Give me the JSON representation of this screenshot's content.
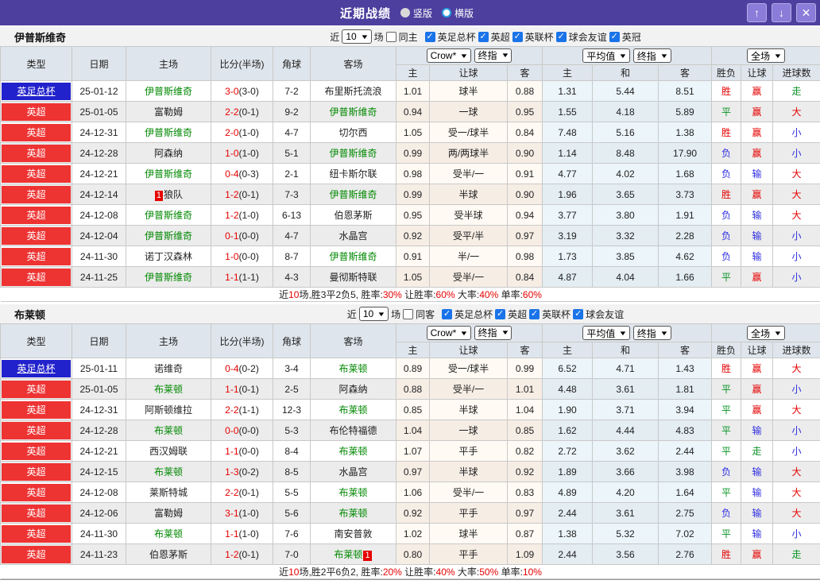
{
  "colors": {
    "titlebar_bg": "#4d3f9e",
    "league_premier_bg": "#ee3333",
    "league_cup_bg": "#2222cc",
    "focus_team_green": "#008800",
    "score_red": "#e60000",
    "win_red": "#e60000",
    "draw_green": "#089424",
    "lose_blue": "#2e2ee0",
    "header_bg": "#dfe5ec",
    "row_alt_bg": "#ececec",
    "checkbox_blue": "#1a73e8"
  },
  "icons": {
    "up": "↑",
    "down": "↓",
    "close": "✕",
    "check": "✓",
    "chevron": "▼"
  },
  "titlebar": {
    "title": "近期战绩",
    "radios": [
      {
        "label": "竖版",
        "style": "filled"
      },
      {
        "label": "横版",
        "style": "blue-ring"
      }
    ]
  },
  "table_header": {
    "cols": [
      "类型",
      "日期",
      "主场",
      "比分(半场)",
      "角球",
      "客场"
    ],
    "odds_group_selects": [
      "Crow*",
      "终指"
    ],
    "avg_group_selects": [
      "平均值",
      "终指"
    ],
    "full_select": "全场",
    "odds_sub": [
      "主",
      "让球",
      "客"
    ],
    "avg_sub": [
      "主",
      "和",
      "客"
    ],
    "result_sub": [
      "胜负",
      "让球",
      "进球数"
    ]
  },
  "sections": [
    {
      "team": "伊普斯维奇",
      "filter": {
        "near_label": "近",
        "count": "10",
        "games_label": "场",
        "same_label": "同主",
        "same_checked": false,
        "leagues": [
          "英足总杯",
          "英超",
          "英联杯",
          "球会友谊",
          "英冠"
        ]
      },
      "rows": [
        {
          "league": "英足总杯",
          "league_style": "cup",
          "date": "25-01-12",
          "home": "伊普斯维奇",
          "home_focus": true,
          "home_badge": null,
          "score_ft": "3-0",
          "score_ht": "(3-0)",
          "corner": "7-2",
          "away": "布里斯托流浪",
          "away_focus": false,
          "away_badge": null,
          "odds": [
            "1.01",
            "球半",
            "0.88"
          ],
          "avg": [
            "1.31",
            "5.44",
            "8.51"
          ],
          "outcome": "胜",
          "let_result": "赢",
          "goal_result": "走"
        },
        {
          "league": "英超",
          "league_style": "red",
          "date": "25-01-05",
          "home": "富勒姆",
          "home_focus": false,
          "home_badge": null,
          "score_ft": "2-2",
          "score_ht": "(0-1)",
          "corner": "9-2",
          "away": "伊普斯维奇",
          "away_focus": true,
          "away_badge": null,
          "odds": [
            "0.94",
            "一球",
            "0.95"
          ],
          "avg": [
            "1.55",
            "4.18",
            "5.89"
          ],
          "outcome": "平",
          "let_result": "赢",
          "goal_result": "大"
        },
        {
          "league": "英超",
          "league_style": "red",
          "date": "24-12-31",
          "home": "伊普斯维奇",
          "home_focus": true,
          "home_badge": null,
          "score_ft": "2-0",
          "score_ht": "(1-0)",
          "corner": "4-7",
          "away": "切尔西",
          "away_focus": false,
          "away_badge": null,
          "odds": [
            "1.05",
            "受一/球半",
            "0.84"
          ],
          "avg": [
            "7.48",
            "5.16",
            "1.38"
          ],
          "outcome": "胜",
          "let_result": "赢",
          "goal_result": "小"
        },
        {
          "league": "英超",
          "league_style": "red",
          "date": "24-12-28",
          "home": "阿森纳",
          "home_focus": false,
          "home_badge": null,
          "score_ft": "1-0",
          "score_ht": "(1-0)",
          "corner": "5-1",
          "away": "伊普斯维奇",
          "away_focus": true,
          "away_badge": null,
          "odds": [
            "0.99",
            "两/两球半",
            "0.90"
          ],
          "avg": [
            "1.14",
            "8.48",
            "17.90"
          ],
          "outcome": "负",
          "let_result": "赢",
          "goal_result": "小"
        },
        {
          "league": "英超",
          "league_style": "red",
          "date": "24-12-21",
          "home": "伊普斯维奇",
          "home_focus": true,
          "home_badge": null,
          "score_ft": "0-4",
          "score_ht": "(0-3)",
          "corner": "2-1",
          "away": "纽卡斯尔联",
          "away_focus": false,
          "away_badge": null,
          "odds": [
            "0.98",
            "受半/一",
            "0.91"
          ],
          "avg": [
            "4.77",
            "4.02",
            "1.68"
          ],
          "outcome": "负",
          "let_result": "输",
          "goal_result": "大"
        },
        {
          "league": "英超",
          "league_style": "red",
          "date": "24-12-14",
          "home": "狼队",
          "home_focus": false,
          "home_badge": {
            "text": "1",
            "pos": "before"
          },
          "score_ft": "1-2",
          "score_ht": "(0-1)",
          "corner": "7-3",
          "away": "伊普斯维奇",
          "away_focus": true,
          "away_badge": null,
          "odds": [
            "0.99",
            "半球",
            "0.90"
          ],
          "avg": [
            "1.96",
            "3.65",
            "3.73"
          ],
          "outcome": "胜",
          "let_result": "赢",
          "goal_result": "大"
        },
        {
          "league": "英超",
          "league_style": "red",
          "date": "24-12-08",
          "home": "伊普斯维奇",
          "home_focus": true,
          "home_badge": null,
          "score_ft": "1-2",
          "score_ht": "(1-0)",
          "corner": "6-13",
          "away": "伯恩茅斯",
          "away_focus": false,
          "away_badge": null,
          "odds": [
            "0.95",
            "受半球",
            "0.94"
          ],
          "avg": [
            "3.77",
            "3.80",
            "1.91"
          ],
          "outcome": "负",
          "let_result": "输",
          "goal_result": "大"
        },
        {
          "league": "英超",
          "league_style": "red",
          "date": "24-12-04",
          "home": "伊普斯维奇",
          "home_focus": true,
          "home_badge": null,
          "score_ft": "0-1",
          "score_ht": "(0-0)",
          "corner": "4-7",
          "away": "水晶宫",
          "away_focus": false,
          "away_badge": null,
          "odds": [
            "0.92",
            "受平/半",
            "0.97"
          ],
          "avg": [
            "3.19",
            "3.32",
            "2.28"
          ],
          "outcome": "负",
          "let_result": "输",
          "goal_result": "小"
        },
        {
          "league": "英超",
          "league_style": "red",
          "date": "24-11-30",
          "home": "诺丁汉森林",
          "home_focus": false,
          "home_badge": null,
          "score_ft": "1-0",
          "score_ht": "(0-0)",
          "corner": "8-7",
          "away": "伊普斯维奇",
          "away_focus": true,
          "away_badge": null,
          "odds": [
            "0.91",
            "半/一",
            "0.98"
          ],
          "avg": [
            "1.73",
            "3.85",
            "4.62"
          ],
          "outcome": "负",
          "let_result": "输",
          "goal_result": "小"
        },
        {
          "league": "英超",
          "league_style": "red",
          "date": "24-11-25",
          "home": "伊普斯维奇",
          "home_focus": true,
          "home_badge": null,
          "score_ft": "1-1",
          "score_ht": "(1-1)",
          "corner": "4-3",
          "away": "曼彻斯特联",
          "away_focus": false,
          "away_badge": null,
          "odds": [
            "1.05",
            "受半/一",
            "0.84"
          ],
          "avg": [
            "4.87",
            "4.04",
            "1.66"
          ],
          "outcome": "平",
          "let_result": "赢",
          "goal_result": "小"
        }
      ],
      "summary": [
        {
          "text": "近"
        },
        {
          "text": "10",
          "red": true
        },
        {
          "text": "场,胜3平2负5, 胜率:"
        },
        {
          "text": "30%",
          "red": true
        },
        {
          "text": " 让胜率:"
        },
        {
          "text": "60%",
          "red": true
        },
        {
          "text": " 大率:"
        },
        {
          "text": "40%",
          "red": true
        },
        {
          "text": " 单率:"
        },
        {
          "text": "60%",
          "red": true
        }
      ]
    },
    {
      "team": "布莱顿",
      "filter": {
        "near_label": "近",
        "count": "10",
        "games_label": "场",
        "same_label": "同客",
        "same_checked": false,
        "leagues": [
          "英足总杯",
          "英超",
          "英联杯",
          "球会友谊"
        ]
      },
      "rows": [
        {
          "league": "英足总杯",
          "league_style": "cup",
          "date": "25-01-11",
          "home": "诺维奇",
          "home_focus": false,
          "home_badge": null,
          "score_ft": "0-4",
          "score_ht": "(0-2)",
          "corner": "3-4",
          "away": "布莱顿",
          "away_focus": true,
          "away_badge": null,
          "odds": [
            "0.89",
            "受一/球半",
            "0.99"
          ],
          "avg": [
            "6.52",
            "4.71",
            "1.43"
          ],
          "outcome": "胜",
          "let_result": "赢",
          "goal_result": "大"
        },
        {
          "league": "英超",
          "league_style": "red",
          "date": "25-01-05",
          "home": "布莱顿",
          "home_focus": true,
          "home_badge": null,
          "score_ft": "1-1",
          "score_ht": "(0-1)",
          "corner": "2-5",
          "away": "阿森纳",
          "away_focus": false,
          "away_badge": null,
          "odds": [
            "0.88",
            "受半/一",
            "1.01"
          ],
          "avg": [
            "4.48",
            "3.61",
            "1.81"
          ],
          "outcome": "平",
          "let_result": "赢",
          "goal_result": "小"
        },
        {
          "league": "英超",
          "league_style": "red",
          "date": "24-12-31",
          "home": "阿斯顿维拉",
          "home_focus": false,
          "home_badge": null,
          "score_ft": "2-2",
          "score_ht": "(1-1)",
          "corner": "12-3",
          "away": "布莱顿",
          "away_focus": true,
          "away_badge": null,
          "odds": [
            "0.85",
            "半球",
            "1.04"
          ],
          "avg": [
            "1.90",
            "3.71",
            "3.94"
          ],
          "outcome": "平",
          "let_result": "赢",
          "goal_result": "大"
        },
        {
          "league": "英超",
          "league_style": "red",
          "date": "24-12-28",
          "home": "布莱顿",
          "home_focus": true,
          "home_badge": null,
          "score_ft": "0-0",
          "score_ht": "(0-0)",
          "corner": "5-3",
          "away": "布伦特福德",
          "away_focus": false,
          "away_badge": null,
          "odds": [
            "1.04",
            "一球",
            "0.85"
          ],
          "avg": [
            "1.62",
            "4.44",
            "4.83"
          ],
          "outcome": "平",
          "let_result": "输",
          "goal_result": "小"
        },
        {
          "league": "英超",
          "league_style": "red",
          "date": "24-12-21",
          "home": "西汉姆联",
          "home_focus": false,
          "home_badge": null,
          "score_ft": "1-1",
          "score_ht": "(0-0)",
          "corner": "8-4",
          "away": "布莱顿",
          "away_focus": true,
          "away_badge": null,
          "odds": [
            "1.07",
            "平手",
            "0.82"
          ],
          "avg": [
            "2.72",
            "3.62",
            "2.44"
          ],
          "outcome": "平",
          "let_result": "走",
          "goal_result": "小"
        },
        {
          "league": "英超",
          "league_style": "red",
          "date": "24-12-15",
          "home": "布莱顿",
          "home_focus": true,
          "home_badge": null,
          "score_ft": "1-3",
          "score_ht": "(0-2)",
          "corner": "8-5",
          "away": "水晶宫",
          "away_focus": false,
          "away_badge": null,
          "odds": [
            "0.97",
            "半球",
            "0.92"
          ],
          "avg": [
            "1.89",
            "3.66",
            "3.98"
          ],
          "outcome": "负",
          "let_result": "输",
          "goal_result": "大"
        },
        {
          "league": "英超",
          "league_style": "red",
          "date": "24-12-08",
          "home": "莱斯特城",
          "home_focus": false,
          "home_badge": null,
          "score_ft": "2-2",
          "score_ht": "(0-1)",
          "corner": "5-5",
          "away": "布莱顿",
          "away_focus": true,
          "away_badge": null,
          "odds": [
            "1.06",
            "受半/一",
            "0.83"
          ],
          "avg": [
            "4.89",
            "4.20",
            "1.64"
          ],
          "outcome": "平",
          "let_result": "输",
          "goal_result": "大"
        },
        {
          "league": "英超",
          "league_style": "red",
          "date": "24-12-06",
          "home": "富勒姆",
          "home_focus": false,
          "home_badge": null,
          "score_ft": "3-1",
          "score_ht": "(1-0)",
          "corner": "5-6",
          "away": "布莱顿",
          "away_focus": true,
          "away_badge": null,
          "odds": [
            "0.92",
            "平手",
            "0.97"
          ],
          "avg": [
            "2.44",
            "3.61",
            "2.75"
          ],
          "outcome": "负",
          "let_result": "输",
          "goal_result": "大"
        },
        {
          "league": "英超",
          "league_style": "red",
          "date": "24-11-30",
          "home": "布莱顿",
          "home_focus": true,
          "home_badge": null,
          "score_ft": "1-1",
          "score_ht": "(1-0)",
          "corner": "7-6",
          "away": "南安普敦",
          "away_focus": false,
          "away_badge": null,
          "odds": [
            "1.02",
            "球半",
            "0.87"
          ],
          "avg": [
            "1.38",
            "5.32",
            "7.02"
          ],
          "outcome": "平",
          "let_result": "输",
          "goal_result": "小"
        },
        {
          "league": "英超",
          "league_style": "red",
          "date": "24-11-23",
          "home": "伯恩茅斯",
          "home_focus": false,
          "home_badge": null,
          "score_ft": "1-2",
          "score_ht": "(0-1)",
          "corner": "7-0",
          "away": "布莱顿",
          "away_focus": true,
          "away_badge": {
            "text": "1",
            "pos": "after"
          },
          "odds": [
            "0.80",
            "平手",
            "1.09"
          ],
          "avg": [
            "2.44",
            "3.56",
            "2.76"
          ],
          "outcome": "胜",
          "let_result": "赢",
          "goal_result": "走"
        }
      ],
      "summary": [
        {
          "text": "近"
        },
        {
          "text": "10",
          "red": true
        },
        {
          "text": "场,胜2平6负2, 胜率:"
        },
        {
          "text": "20%",
          "red": true
        },
        {
          "text": " 让胜率:"
        },
        {
          "text": "40%",
          "red": true
        },
        {
          "text": " 大率:"
        },
        {
          "text": "50%",
          "red": true
        },
        {
          "text": " 单率:"
        },
        {
          "text": "10%",
          "red": true
        }
      ]
    }
  ]
}
